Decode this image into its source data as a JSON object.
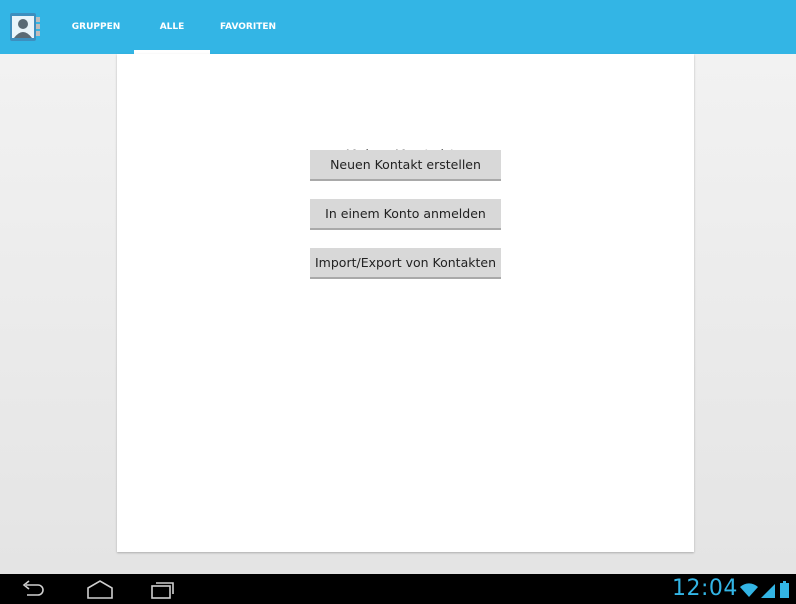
{
  "app": {
    "icon": "contacts-app-icon"
  },
  "tabs": [
    {
      "label": "GRUPPEN",
      "selected": false
    },
    {
      "label": "ALLE",
      "selected": true
    },
    {
      "label": "FAVORITEN",
      "selected": false
    }
  ],
  "empty_state": {
    "title": "Keine Kontakte",
    "buttons": [
      "Neuen Kontakt erstellen",
      "In einem Konto anmelden",
      "Import/Export von Kontakten"
    ]
  },
  "navbar": {
    "icons": [
      "back-icon",
      "home-icon",
      "recent-apps-icon"
    ]
  },
  "status": {
    "time": "12:04",
    "icons": [
      "wifi-icon",
      "signal-icon",
      "battery-icon"
    ]
  },
  "colors": {
    "accent": "#33b5e5",
    "navbar": "#000000",
    "button": "#d8d8d8"
  }
}
